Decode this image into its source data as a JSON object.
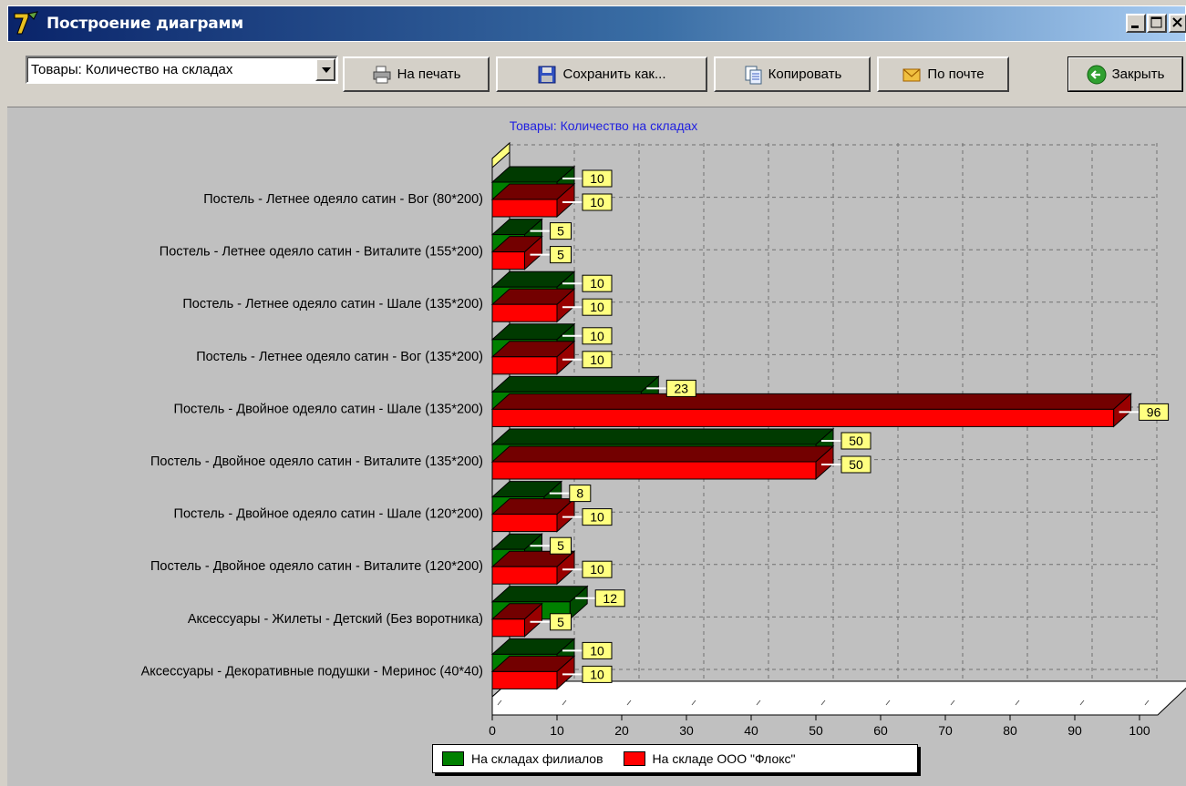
{
  "window": {
    "title": "Построение диаграмм",
    "icon": "app-logo-icon"
  },
  "toolbar": {
    "chart_select_value": "Товары: Количество на складах",
    "print_label": "На печать",
    "save_as_label": "Сохранить как...",
    "copy_label": "Копировать",
    "email_label": "По почте",
    "close_label": "Закрыть"
  },
  "colors": {
    "series_branches": "#008000",
    "series_main": "#ff0000",
    "title": "#2020e0",
    "label_box": "#ffff80",
    "background": "#c0c0c0"
  },
  "chart_data": {
    "type": "bar",
    "orientation": "horizontal",
    "style": "3d",
    "title": "Товары: Количество на складах",
    "categories": [
      "Постель - Летнее одеяло сатин - Вог (80*200)",
      "Постель - Летнее одеяло сатин - Виталите (155*200)",
      "Постель - Летнее одеяло сатин - Шале (135*200)",
      "Постель - Летнее одеяло сатин - Вог (135*200)",
      "Постель - Двойное одеяло сатин - Шале (135*200)",
      "Постель - Двойное одеяло сатин - Виталите (135*200)",
      "Постель - Двойное одеяло сатин - Шале (120*200)",
      "Постель - Двойное одеяло сатин - Виталите (120*200)",
      "Аксессуары - Жилеты - Детский (Без воротника)",
      "Аксессуары - Декоративные подушки - Меринос (40*40)"
    ],
    "series": [
      {
        "name": "На складах филиалов",
        "color": "#008000",
        "values": [
          10,
          5,
          10,
          10,
          23,
          50,
          8,
          5,
          12,
          10
        ]
      },
      {
        "name": "На складе ООО \"Флокс\"",
        "color": "#ff0000",
        "values": [
          10,
          5,
          10,
          10,
          96,
          50,
          10,
          10,
          5,
          10
        ]
      }
    ],
    "xlim": [
      0,
      100
    ],
    "x_ticks": [
      "0",
      "10",
      "20",
      "30",
      "40",
      "50",
      "60",
      "70",
      "80",
      "90",
      "100"
    ],
    "grid": true,
    "data_labels": true,
    "legend_position": "bottom"
  }
}
